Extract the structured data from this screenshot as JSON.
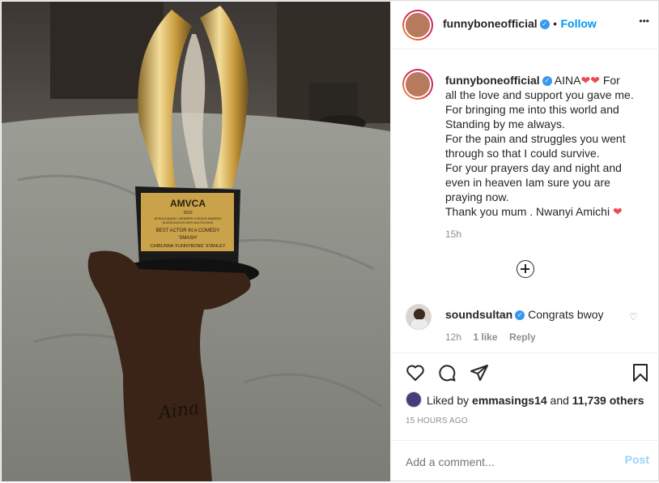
{
  "post": {
    "author": "funnyboneofficial",
    "follow_separator": "•",
    "follow_label": "Follow",
    "more_glyph": "•••",
    "caption_first": "AINA",
    "caption_lines": [
      "For",
      "all the love and support you gave me.",
      "For bringing me into this world and",
      "Standing by me always.",
      "For the pain and struggles you went",
      "through so that I could survive.",
      "For your prayers day and night and",
      "even in heaven Iam sure you are",
      "praying now.",
      "Thank you mum . Nwanyi Amichi"
    ],
    "caption_time": "15h",
    "photo_trophy_text": {
      "logo": "AMVCA",
      "year": "2020",
      "org1": "AFRICA MAGIC VIEWERS CHOICE AWARDS",
      "org2": "IN ASSOCIATION WITH MULTICHOICE",
      "category": "BEST ACTOR IN A COMEDY",
      "film": "'SMASH'",
      "winner": "CHIBUNNA 'FUNNYBONE' STANLEY",
      "tattoo": "Aina"
    }
  },
  "comment": {
    "user": "soundsultan",
    "text": "Congrats bwoy",
    "time": "12h",
    "likes": "1 like",
    "reply": "Reply"
  },
  "likes": {
    "prefix": "Liked by",
    "user": "emmasings14",
    "and": "and",
    "others": "11,739 others"
  },
  "timestamp": "15 HOURS AGO",
  "add_comment": {
    "placeholder": "Add a comment...",
    "post_label": "Post"
  },
  "colors": {
    "accent": "#0095f6",
    "heart": "#ed4956",
    "verified": "#3897f0"
  }
}
